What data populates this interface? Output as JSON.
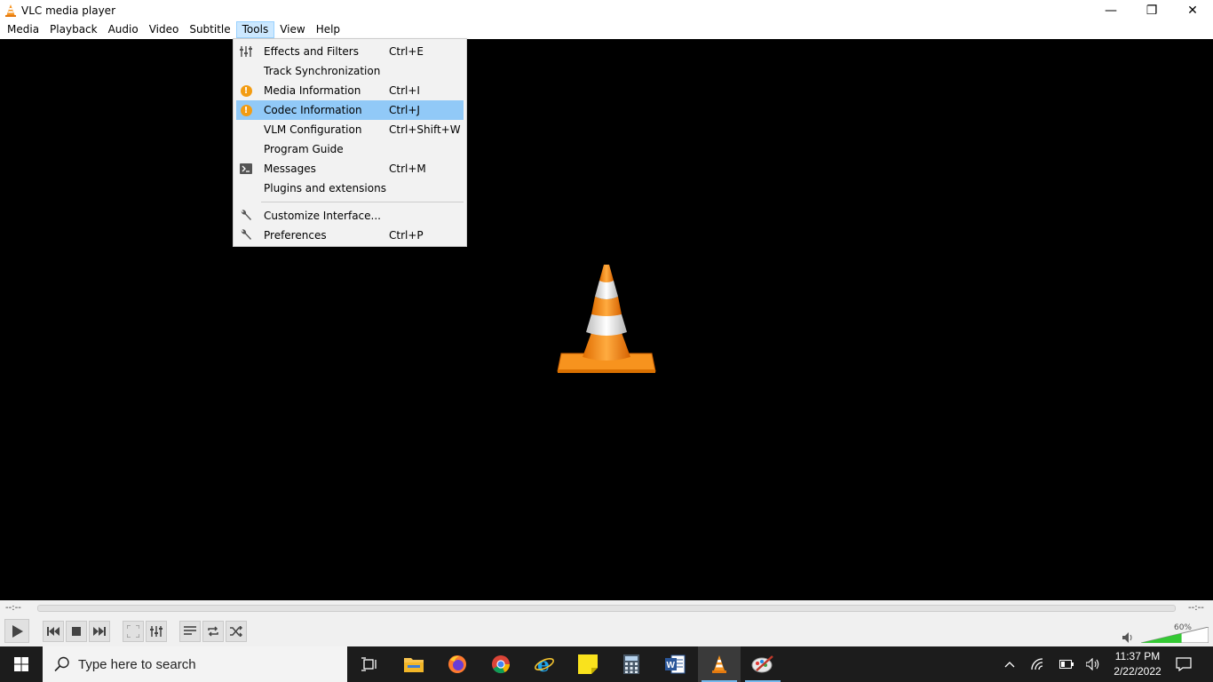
{
  "window": {
    "title": "VLC media player",
    "minimize_glyph": "—",
    "restore_glyph": "❐",
    "close_glyph": "✕"
  },
  "menubar": {
    "items": [
      {
        "label": "Media"
      },
      {
        "label": "Playback"
      },
      {
        "label": "Audio"
      },
      {
        "label": "Video"
      },
      {
        "label": "Subtitle"
      },
      {
        "label": "Tools"
      },
      {
        "label": "View"
      },
      {
        "label": "Help"
      }
    ],
    "active": "Tools"
  },
  "tools_menu": {
    "items": [
      {
        "label": "Effects and Filters",
        "shortcut": "Ctrl+E",
        "icon": "equalizer-icon"
      },
      {
        "label": "Track Synchronization",
        "shortcut": "",
        "icon": ""
      },
      {
        "label": "Media Information",
        "shortcut": "Ctrl+I",
        "icon": "info-icon"
      },
      {
        "label": "Codec Information",
        "shortcut": "Ctrl+J",
        "icon": "info-icon",
        "highlighted": true
      },
      {
        "label": "VLM Configuration",
        "shortcut": "Ctrl+Shift+W",
        "icon": ""
      },
      {
        "label": "Program Guide",
        "shortcut": "",
        "icon": ""
      },
      {
        "label": "Messages",
        "shortcut": "Ctrl+M",
        "icon": "terminal-icon"
      },
      {
        "label": "Plugins and extensions",
        "shortcut": "",
        "icon": ""
      },
      {
        "label": "Customize Interface...",
        "shortcut": "",
        "icon": "wrench-icon"
      },
      {
        "label": "Preferences",
        "shortcut": "Ctrl+P",
        "icon": "wrench-icon"
      }
    ]
  },
  "playback": {
    "elapsed": "--:--",
    "remaining": "--:--",
    "volume_label": "60%",
    "volume_level": 0.6
  },
  "taskbar": {
    "search_placeholder": "Type here to search",
    "time": "11:37 PM",
    "date": "2/22/2022",
    "apps": [
      "task-view-icon",
      "file-explorer-icon",
      "firefox-icon",
      "chrome-icon",
      "internet-explorer-icon",
      "sticky-notes-icon",
      "calculator-icon",
      "word-icon",
      "vlc-icon",
      "paint-icon"
    ]
  },
  "colors": {
    "menu_highlight": "#91c9f7",
    "menu_active": "#cce8ff",
    "cone_orange": "#f7931e",
    "taskbar_bg": "#1c1c1c",
    "volume_green": "#34c934"
  }
}
